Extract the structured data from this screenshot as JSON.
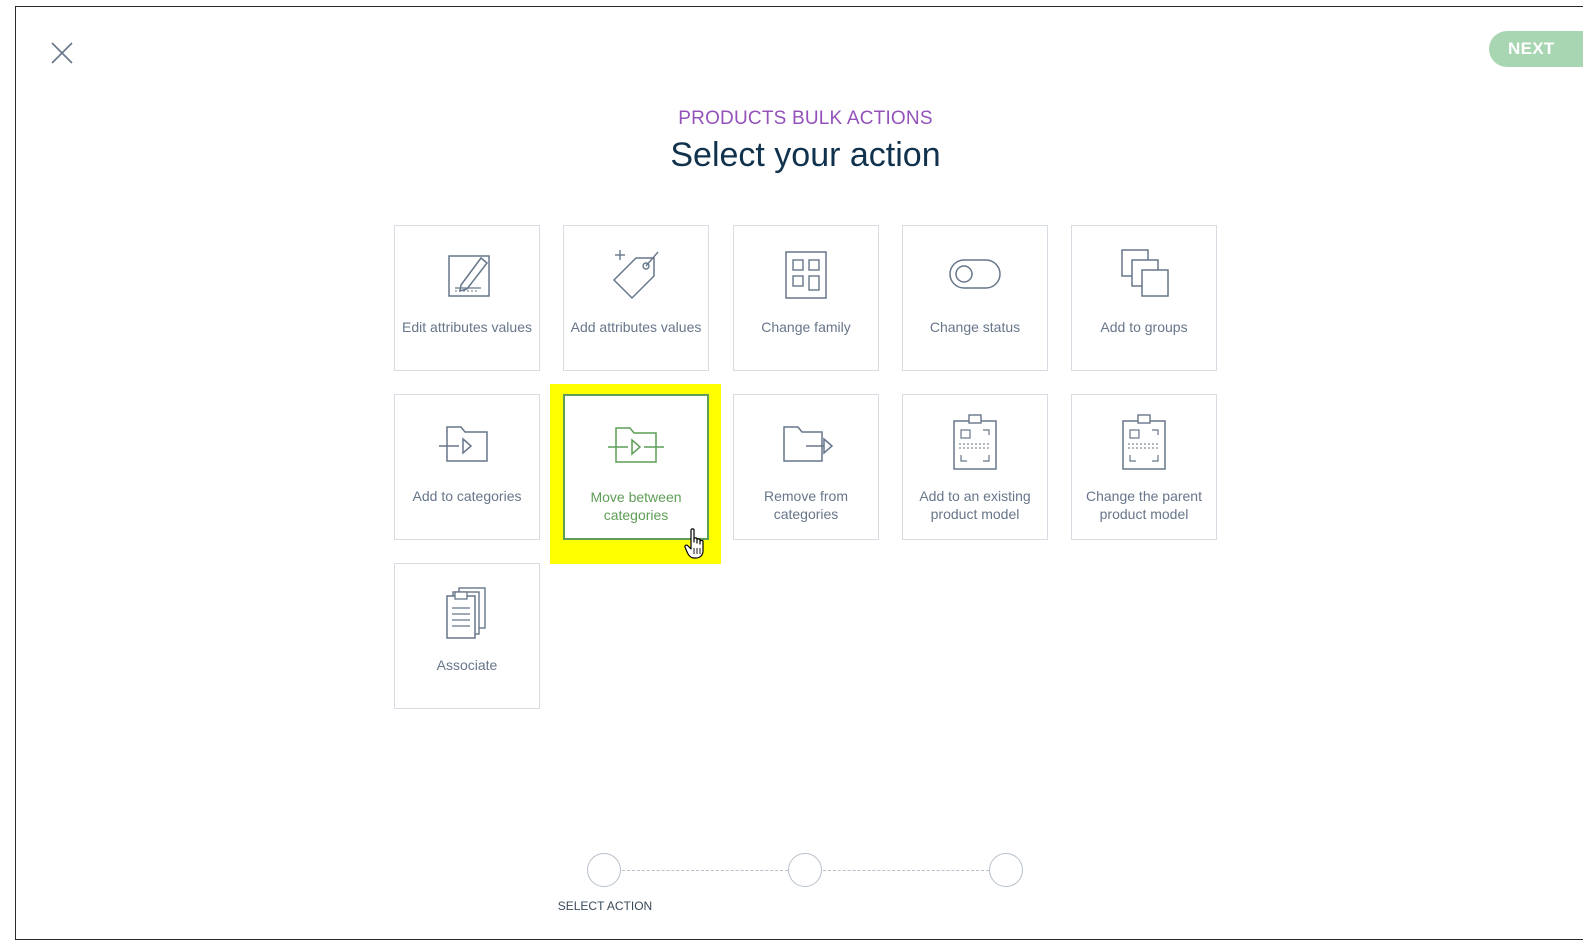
{
  "header": {
    "subtitle": "PRODUCTS BULK ACTIONS",
    "title": "Select your action",
    "next_label": "NEXT"
  },
  "tiles": [
    {
      "label": "Edit attributes values",
      "icon": "edit-attributes-icon"
    },
    {
      "label": "Add attributes values",
      "icon": "tag-plus-icon"
    },
    {
      "label": "Change family",
      "icon": "family-layout-icon"
    },
    {
      "label": "Change status",
      "icon": "toggle-icon"
    },
    {
      "label": "Add to groups",
      "icon": "stacked-squares-icon"
    },
    {
      "label": "Add to categories",
      "icon": "folder-add-icon"
    },
    {
      "label": "Move between categories",
      "icon": "folder-move-icon"
    },
    {
      "label": "Remove from categories",
      "icon": "folder-remove-icon"
    },
    {
      "label": "Add to an existing product model",
      "icon": "clipboard-model-icon"
    },
    {
      "label": "Change the parent product model",
      "icon": "clipboard-parent-icon"
    },
    {
      "label": "Associate",
      "icon": "associate-icon"
    }
  ],
  "selected_tile": "Move between categories",
  "stepper": {
    "steps": [
      {
        "label": "SELECT ACTION"
      },
      {
        "label": ""
      },
      {
        "label": ""
      }
    ]
  },
  "colors": {
    "accent_purple": "#9452ba",
    "next_button": "#a9d6b2",
    "selected_green": "#5e9e56",
    "highlight_yellow": "#ffff00"
  }
}
